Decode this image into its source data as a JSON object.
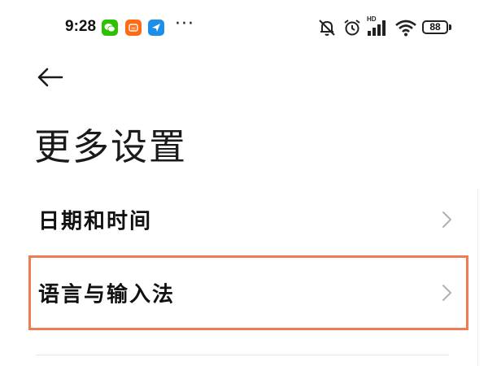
{
  "status_bar": {
    "time": "9:28",
    "notification_icons": [
      "wechat-icon",
      "mi-app-icon",
      "send-icon"
    ],
    "more_indicator": "···",
    "system_icons": [
      "mute-icon",
      "alarm-icon",
      "hd-signal-icon",
      "wifi-icon",
      "battery-icon"
    ],
    "signal_badge": "HD",
    "battery_level": "88"
  },
  "header": {
    "back_icon": "arrow-left-icon",
    "title": "更多设置"
  },
  "list": {
    "items": [
      {
        "label": "日期和时间",
        "icon": "chevron-right-icon"
      },
      {
        "label": "语言与输入法",
        "icon": "chevron-right-icon"
      }
    ]
  },
  "colors": {
    "highlight_border": "#f07a52",
    "wechat": "#2dc100",
    "mi": "#ff6a13",
    "send": "#1e8fe8",
    "chevron": "#b0b0b0"
  }
}
